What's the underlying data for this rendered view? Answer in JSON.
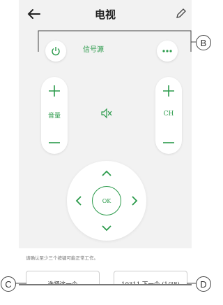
{
  "header": {
    "title": "电视"
  },
  "top_row": {
    "signal_label": "信号源"
  },
  "volume": {
    "label": "音量"
  },
  "channel": {
    "label": "CH"
  },
  "dpad": {
    "ok_label": "OK"
  },
  "bottom": {
    "hint": "请确认至少三个按键可能正常工作。",
    "select_label": "选择这一个",
    "next_label": "10311 下一个 (1/38)"
  },
  "callouts": {
    "b": "B",
    "c": "C",
    "d": "D"
  },
  "colors": {
    "accent": "#2a9a4a",
    "background": "#f2f2f2"
  },
  "icons": [
    "back-arrow-icon",
    "edit-pencil-icon",
    "power-icon",
    "more-icon",
    "mute-icon",
    "plus-icon",
    "minus-icon",
    "chevron-up-icon",
    "chevron-down-icon",
    "chevron-left-icon",
    "chevron-right-icon"
  ]
}
